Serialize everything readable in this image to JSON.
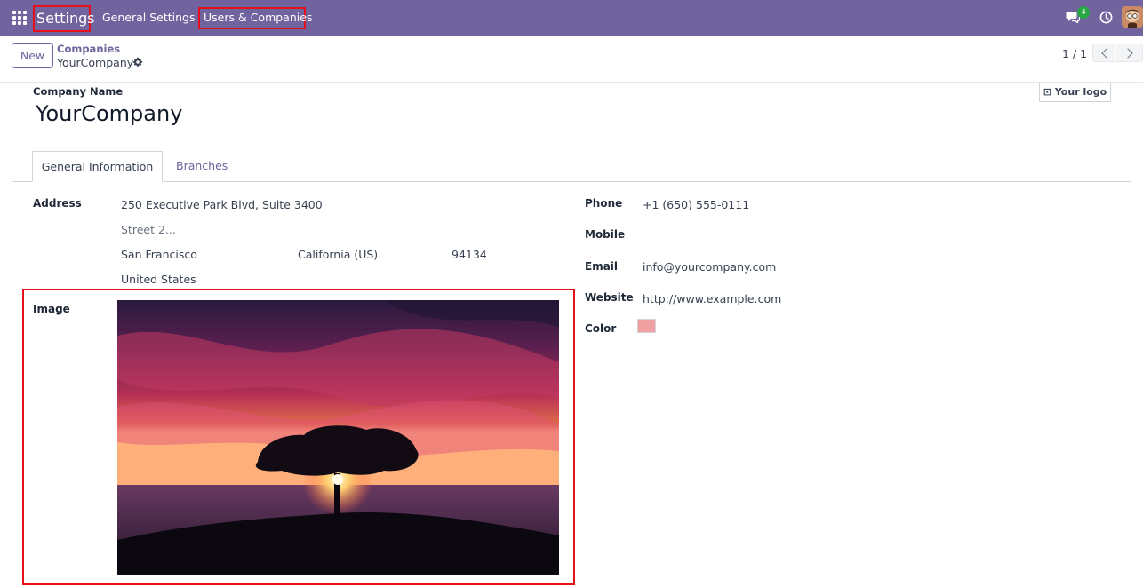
{
  "navbar": {
    "app_name": "Settings",
    "menu": [
      "General Settings",
      "Users & Companies"
    ],
    "chat_count": "4",
    "accent_color": "#71639e"
  },
  "control_panel": {
    "new_label": "New",
    "breadcrumb_parent": "Companies",
    "breadcrumb_current": "YourCompany",
    "pager": "1 / 1"
  },
  "form": {
    "company_name_label": "Company Name",
    "company_name": "YourCompany",
    "logo_button": "Your logo",
    "tabs": [
      "General Information",
      "Branches"
    ],
    "address_label": "Address",
    "street": "250 Executive Park Blvd, Suite 3400",
    "street2_placeholder": "Street 2...",
    "city": "San Francisco",
    "state": "California (US)",
    "zip": "94134",
    "country": "United States",
    "image_label": "Image",
    "phone_label": "Phone",
    "phone": "+1 (650) 555-0111",
    "mobile_label": "Mobile",
    "email_label": "Email",
    "email": "info@yourcompany.com",
    "website_label": "Website",
    "website": "http://www.example.com",
    "color_label": "Color",
    "color_value": "#f0a0a0"
  }
}
